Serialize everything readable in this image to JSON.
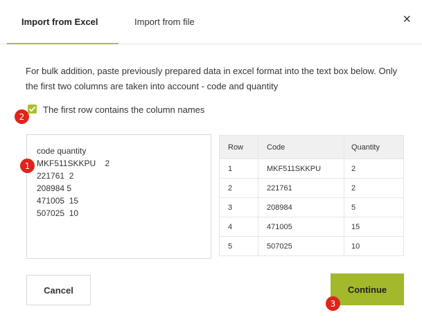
{
  "tabs": [
    {
      "label": "Import from Excel",
      "active": true
    },
    {
      "label": "Import from file",
      "active": false
    }
  ],
  "close_glyph": "×",
  "description": "For bulk addition, paste previously prepared data in excel format into the text box below. Only the first two columns are taken into account - code and quantity",
  "header_checkbox": {
    "label": "The first row contains the column names",
    "checked": true
  },
  "textbox": {
    "lines": [
      "code quantity",
      "MKF511SKKPU    2",
      "221761  2",
      "208984 5",
      "471005  15",
      "507025  10"
    ]
  },
  "preview_table": {
    "headers": [
      "Row",
      "Code",
      "Quantity"
    ],
    "rows": [
      [
        "1",
        "MKF511SKKPU",
        "2"
      ],
      [
        "2",
        "221761",
        "2"
      ],
      [
        "3",
        "208984",
        "5"
      ],
      [
        "4",
        "471005",
        "15"
      ],
      [
        "5",
        "507025",
        "10"
      ]
    ]
  },
  "buttons": {
    "cancel": "Cancel",
    "continue": "Continue"
  },
  "markers": [
    "1",
    "2",
    "3"
  ],
  "colors": {
    "accent": "#a9bf2e",
    "button": "#a4b82c",
    "marker": "#e0241b"
  },
  "icons": {
    "close": "close-icon",
    "check": "check-icon"
  }
}
